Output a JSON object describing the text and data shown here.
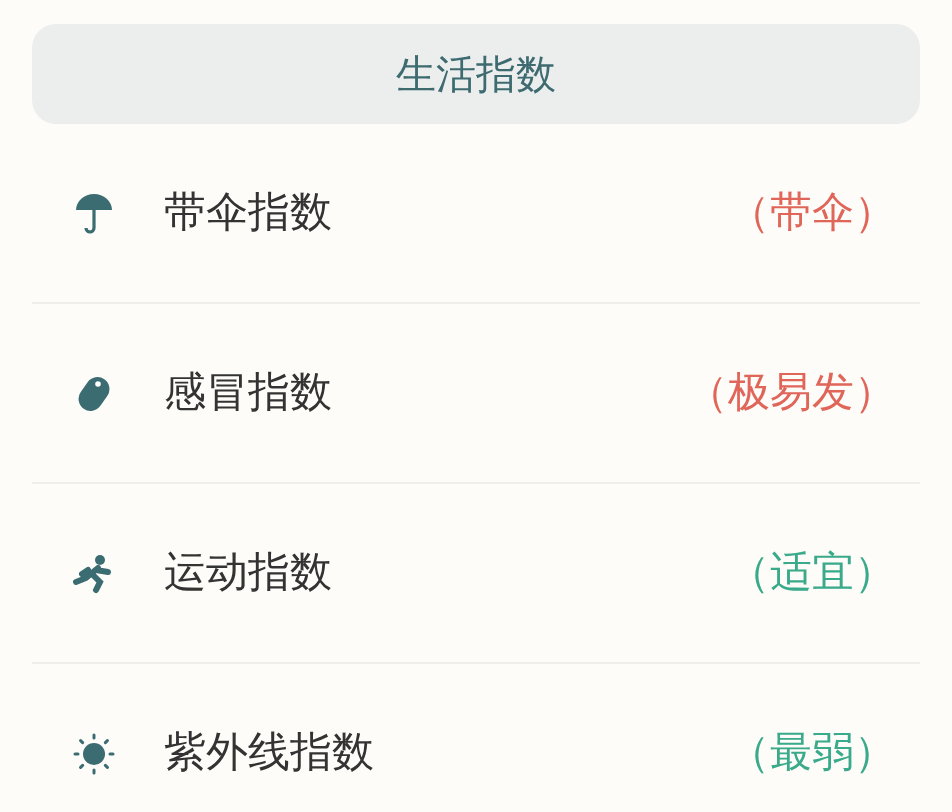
{
  "header": {
    "title": "生活指数"
  },
  "items": [
    {
      "label": "带伞指数",
      "value": "（带伞）",
      "color": "#e0665a"
    },
    {
      "label": "感冒指数",
      "value": "（极易发）",
      "color": "#e0665a"
    },
    {
      "label": "运动指数",
      "value": "（适宜）",
      "color": "#3aaa8a"
    },
    {
      "label": "紫外线指数",
      "value": "（最弱）",
      "color": "#3aaa8a"
    }
  ]
}
